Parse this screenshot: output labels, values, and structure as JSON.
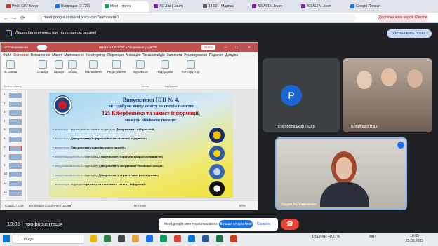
{
  "browser": {
    "tabs": [
      {
        "label": "Pw0: XXV Всеук",
        "color": "#d93025"
      },
      {
        "label": "Входящие (1 726)",
        "color": "#1a73e8"
      },
      {
        "label": "Meet – проєк",
        "color": "#0f9d58"
      },
      {
        "label": "AD Alta | Journ",
        "color": "#7b1fa2"
      },
      {
        "label": "14/02 – Magnus",
        "color": "#5f6368"
      },
      {
        "label": "AD ALTA: Journ",
        "color": "#7b1fa2"
      },
      {
        "label": "AD ALTA: Journ",
        "color": "#7b1fa2"
      },
      {
        "label": "Google Перекл",
        "color": "#1a73e8"
      }
    ],
    "url": "meet.google.com/vxd-xecy-can?authuser=0",
    "update_label": "Доступна нова версія Chrome"
  },
  "meet": {
    "presenter_label": "Лидия Калениченко (ви, на головном экране)",
    "stop_label": "Остановить показ",
    "participants": [
      {
        "name": "психополіський Ліцей"
      },
      {
        "name": "Бобрушко Віка"
      },
      {
        "name": "Лидия Калениченко"
      }
    ],
    "avatar_letter": "P",
    "clock": "10:05",
    "separator": "|",
    "meeting_name": "профорієнтація",
    "share_text": "meet.google.com транслює вікно.",
    "share_more": "Більше не ділитися",
    "share_hide": "Сховати"
  },
  "ppt": {
    "title": "ННІ ННІ 4 ХНУВС • Збережено у цій ПК",
    "signin": "Увійти",
    "autosave": "Автозбереження",
    "menu": [
      "Файл",
      "Основне",
      "Вставлення",
      "Макет",
      "Малювання",
      "Конструктор",
      "Переходи",
      "Анімація",
      "Показ слайдів",
      "Записати",
      "Рецензування",
      "Подання",
      "Довідка"
    ],
    "ribbon": [
      "Вставити",
      "Слайди",
      "Шрифт",
      "Абзац",
      "Малювання",
      "Редагування",
      "Відповісти",
      "Надбудови",
      "Конструктор"
    ],
    "ribbon_groups": [
      "Буфер обміну",
      "Голос",
      "Надбудови"
    ],
    "slide_numbers": [
      "1",
      "2",
      "3",
      "4",
      "5",
      "6",
      "7",
      "8",
      "9",
      "10",
      "11",
      "12"
    ],
    "status_left": "Слайд 7 з 31",
    "status_lang": "англійська (Сполучені Штати)",
    "status_notes": "Нотатки",
    "zoom": "50%",
    "slide": {
      "title1": "Випускники  ННІ № 4,",
      "title2": "які здобули вищу освіту за спеціальністю",
      "title3": "125 Кібербезпека та захист інформації,",
      "title4": "можуть обіймати посади:",
      "bullets": [
        {
          "role": "інспектора",
          "dept": " та спеціаліста оселіти підрозділа ",
          "bold": "Департаменту кіберполіції;"
        },
        {
          "role": "інспектора",
          "dept": " ",
          "bold": "Департаменту інформаційно-аналітичної підтримки;"
        },
        {
          "role": "інспектора",
          "dept": " ",
          "bold": "Департаменту кримінального аналізу;"
        },
        {
          "role": "оперуповноваженого",
          "dept": " підрозділа ",
          "bold": "Департаменту боротьби з наркозлочинністю;"
        },
        {
          "role": "оперуповноваженого",
          "dept": " підрозділу ",
          "bold": "Департаменту оперативно-технічних заходів;"
        },
        {
          "role": "оперуповноваженого",
          "dept": " підрозділу ",
          "bold": "Департаменту стратегічних розслідувань;"
        },
        {
          "role": "інспектора",
          "dept": " підрозділів ",
          "bold": "режиму та технічного захисту інформації."
        }
      ]
    }
  },
  "taskbar": {
    "search": "Пошук",
    "weather": "USD/INR +0,27%",
    "lang": "УКР",
    "time": "10:05",
    "date": "25.03.2025"
  }
}
